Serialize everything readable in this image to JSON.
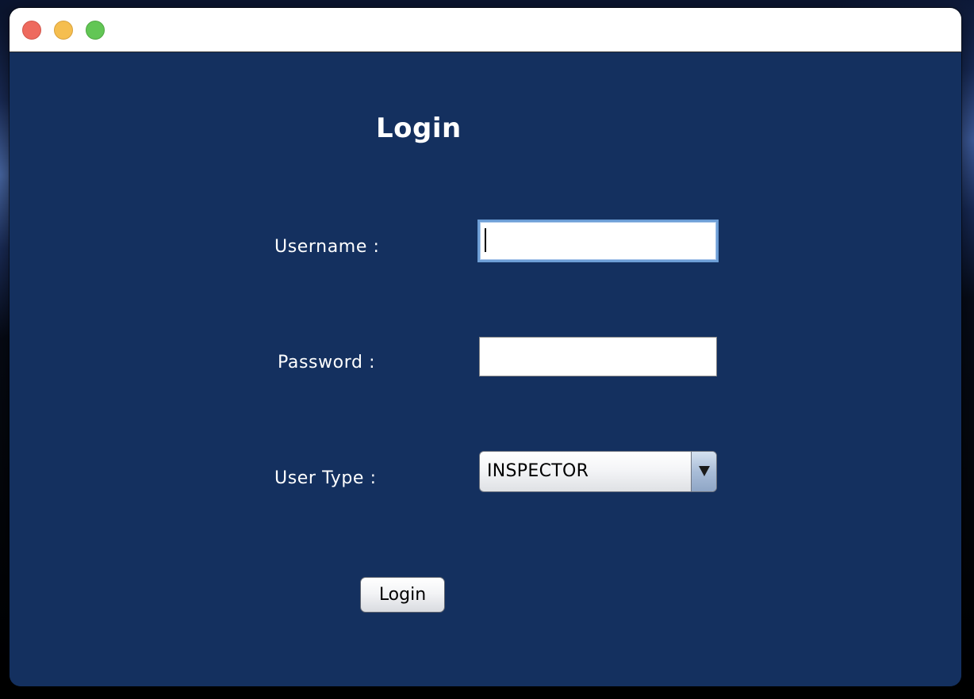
{
  "window": {
    "traffic_lights": {
      "close": "#ee6a5e",
      "minimize": "#f5be4f",
      "zoom": "#62c655"
    },
    "background_color": "#14305f"
  },
  "form": {
    "heading": "Login",
    "username": {
      "label": "Username :",
      "value": ""
    },
    "password": {
      "label": "Password :",
      "value": ""
    },
    "user_type": {
      "label": "User Type :",
      "selected": "INSPECTOR",
      "arrow_icon": "chevron-down-icon"
    },
    "submit_label": "Login"
  }
}
